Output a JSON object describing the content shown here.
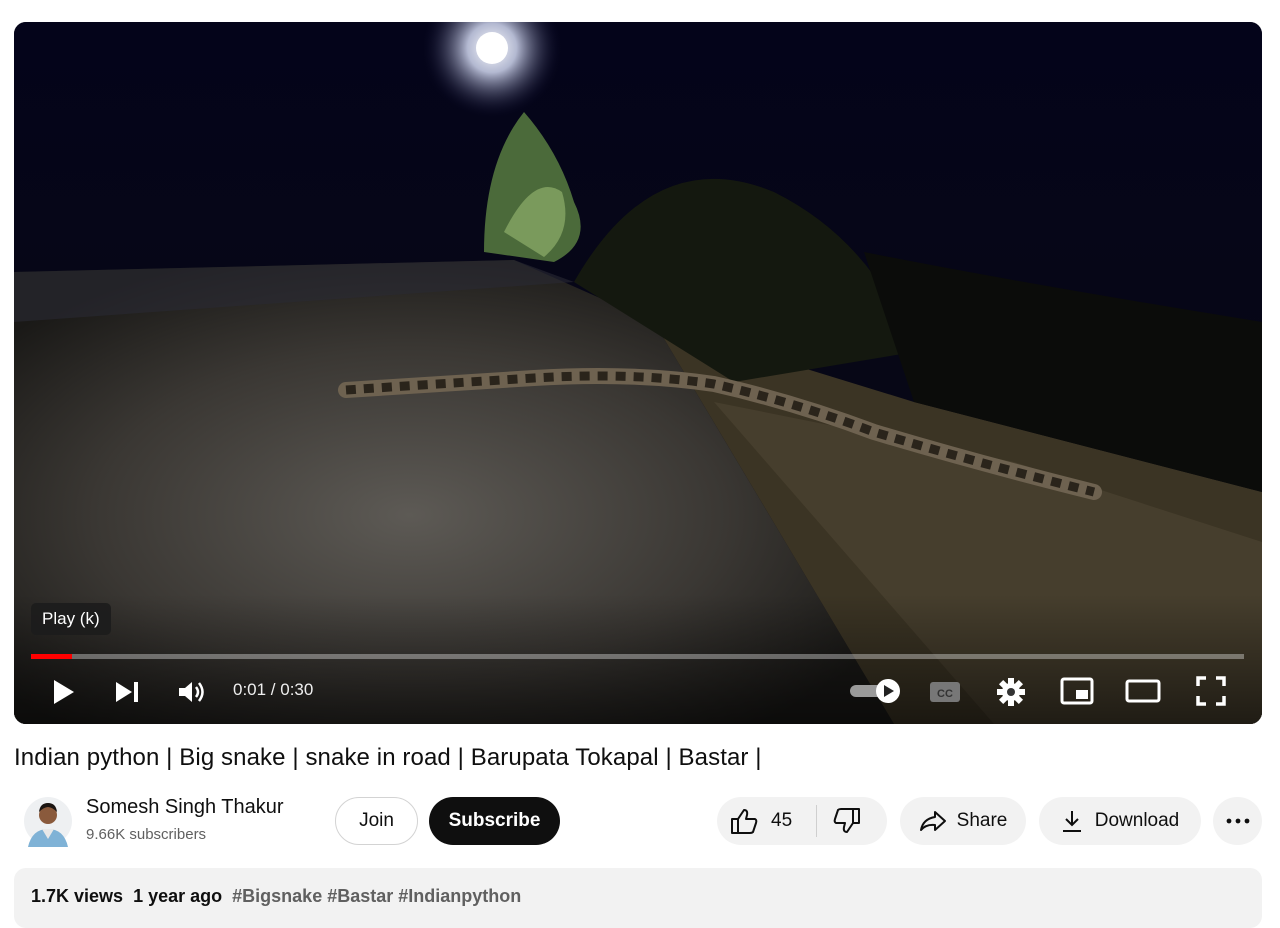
{
  "player": {
    "tooltip": "Play (k)",
    "time": "0:01 / 0:30",
    "progress_fraction": 0.034,
    "accent_color": "#ff0000",
    "controls": [
      "play-icon",
      "next-icon",
      "volume-icon",
      "autoplay-toggle-icon",
      "captions-icon",
      "settings-icon",
      "miniplayer-icon",
      "theater-mode-icon",
      "fullscreen-icon"
    ]
  },
  "video": {
    "title": "Indian python | Big snake | snake in road | Barupata Tokapal | Bastar |"
  },
  "channel": {
    "name": "Somesh Singh Thakur",
    "subscribers": "9.66K subscribers",
    "join_label": "Join",
    "subscribe_label": "Subscribe"
  },
  "actions": {
    "like_count": "45",
    "share_label": "Share",
    "download_label": "Download"
  },
  "description": {
    "views": "1.7K views",
    "age": "1 year ago",
    "hashtags": "#Bigsnake #Bastar #Indianpython"
  }
}
